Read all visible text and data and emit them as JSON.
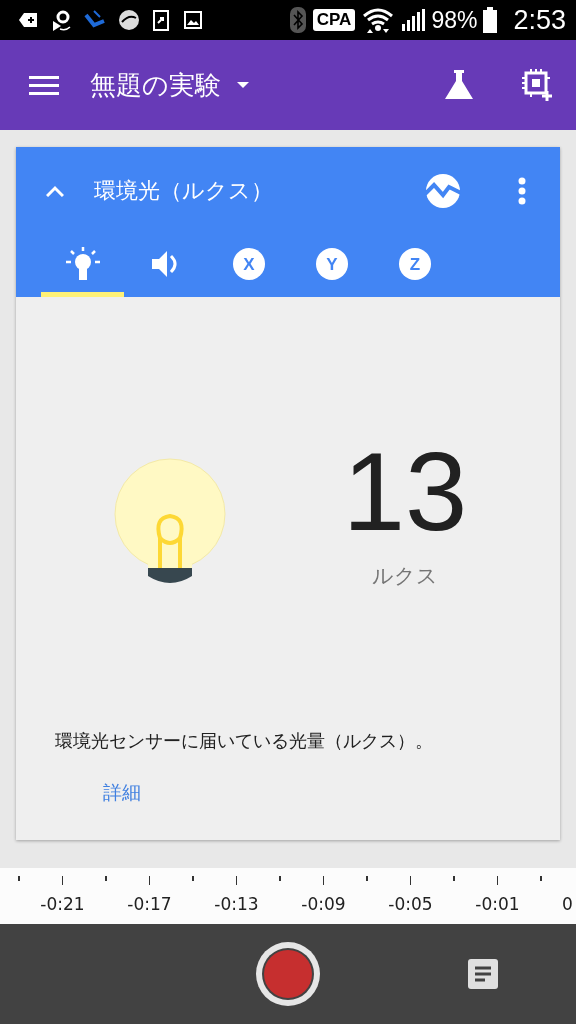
{
  "status_bar": {
    "badge": "CPA",
    "battery": "98%",
    "time": "2:53"
  },
  "app_bar": {
    "title": "無題の実験"
  },
  "card": {
    "title": "環境光（ルクス）",
    "expanded": true,
    "tabs": [
      {
        "kind": "light",
        "selected": true
      },
      {
        "kind": "sound",
        "selected": false
      },
      {
        "kind": "axis",
        "letter": "X",
        "selected": false
      },
      {
        "kind": "axis",
        "letter": "Y",
        "selected": false
      },
      {
        "kind": "axis",
        "letter": "Z",
        "selected": false
      }
    ],
    "reading": {
      "value": "13",
      "unit": "ルクス"
    },
    "description": "環境光センサーに届いている光量（ルクス）。",
    "link": "詳細"
  },
  "timeline": {
    "labels": [
      "-0:21",
      "-0:17",
      "-0:13",
      "-0:09",
      "-0:05",
      "-0:01",
      "0"
    ]
  }
}
